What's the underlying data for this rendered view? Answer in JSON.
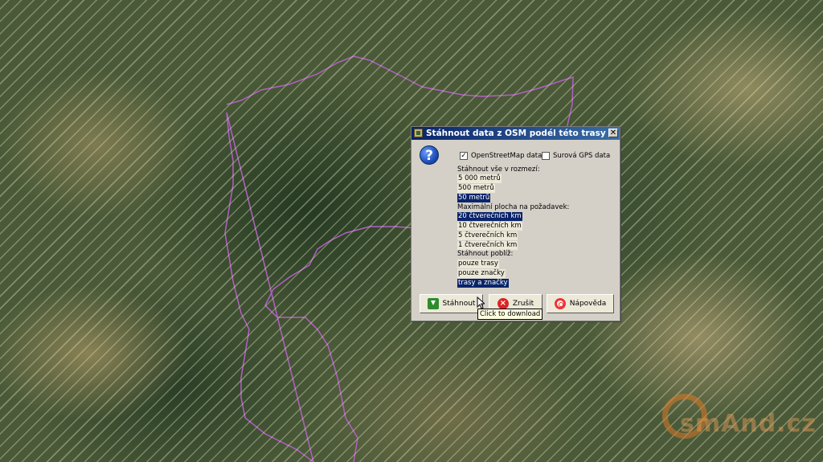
{
  "dialog": {
    "title": "Stáhnout data z OSM podél této trasy",
    "close_glyph": "✕",
    "help_glyph": "?",
    "checkboxes": [
      {
        "label": "OpenStreetMap data",
        "checked": true
      },
      {
        "label": "Surová GPS data",
        "checked": false
      }
    ],
    "check_glyph": "✓",
    "radius_group": {
      "label": "Stáhnout vše v rozmezí:",
      "options": [
        "5 000 metrů",
        "500 metrů",
        "50 metrů"
      ],
      "selected": "50 metrů"
    },
    "area_group": {
      "label": "Maximální plocha na požadavek:",
      "options": [
        "20 čtverečních km",
        "10 čtverečních km",
        "5 čtverečních km",
        "1 čtverečních km"
      ],
      "selected": "20 čtverečních km"
    },
    "near_group": {
      "label": "Stáhnout poblíž:",
      "options": [
        "pouze trasy",
        "pouze značky",
        "trasy a značky"
      ],
      "selected": "trasy a značky"
    },
    "buttons": {
      "download": "Stáhnout",
      "cancel": "Zrušit",
      "help": "Nápověda"
    },
    "tooltip": "Click to download"
  },
  "map": {
    "route_color": "#b45fc8",
    "watermark": "smAnd.cz"
  }
}
